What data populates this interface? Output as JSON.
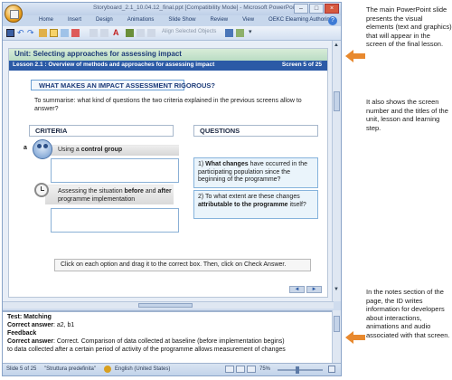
{
  "window": {
    "title": "Storyboard_2.1_10.04.12_final.ppt [Compatibility Mode] - Microsoft PowerPoint",
    "minimize": "–",
    "maximize": "□",
    "close": "×"
  },
  "ribbon": {
    "tabs": [
      "Home",
      "Insert",
      "Design",
      "Animations",
      "Slide Show",
      "Review",
      "View",
      "OEKC Elearning Authoring"
    ],
    "help": "?"
  },
  "toolbar": {
    "undo": "↶",
    "redo": "↷",
    "font_color": "A",
    "align_selected": "Align Selected Objects",
    "more": "▾"
  },
  "slide": {
    "unit_title": "Unit: Selecting approaches for assessing impact",
    "lesson_title": "Lesson 2.1 : Overview of methods and approaches for assessing impact",
    "screen_number": "Screen 5 of 25",
    "question_banner": "WHAT MAKES AN IMPACT ASSESSMENT RIGOROUS?",
    "intro": "To summarise: what kind of questions the two criteria explained in the previous screens allow to answer?",
    "criteria_header": "CRITERIA",
    "questions_header": "QUESTIONS",
    "option_a_letter": "a",
    "option_a_prefix": "Using a ",
    "option_a_bold": "control group",
    "option_b_prefix": "Assessing the situation ",
    "option_b_bold1": "before",
    "option_b_mid": " and ",
    "option_b_bold2": "after",
    "option_b_suffix": " programme implementation",
    "q1_prefix": "1) ",
    "q1_bold": "What changes",
    "q1_suffix": " have occurred in the participating population since the beginning of the programme?",
    "q2_prefix": "2) To what extent are these changes ",
    "q2_bold": "attributable to the programme",
    "q2_suffix": " itself?",
    "instruction": "Click on each option and drag it to the correct box. Then, click on Check Answer.",
    "nav_prev": "◄",
    "nav_next": "►"
  },
  "notes": {
    "test": "Test: Matching",
    "answer_label": "Correct answer",
    "answer_value": ": a2, b1",
    "feedback_label": "Feedback",
    "correct_label": "Correct answer",
    "feedback_text1": ": Correct. Comparison of data collected at baseline (before implementation begins)",
    "feedback_text2": "to data collected after a certain period of activity of the programme allows measurement  of changes"
  },
  "statusbar": {
    "slide": "Slide 5 of 25",
    "theme": "\"Struttura predefinita\"",
    "language": "English (United States)",
    "zoom": "75%"
  },
  "annotations": {
    "p1": "The main PowerPoint slide presents the visual elements (text and graphics) that will appear in the screen of the final lesson.",
    "p2": "It also shows the screen number and the titles of the unit, lesson and learning step.",
    "p3": "In the notes section of the page, the ID writes information for developers about interactions, animations and audio associated with that screen."
  },
  "colors": {
    "accent_arrow": "#e8892e",
    "lesson_bar": "#2b5aa6",
    "unit_bar": "#b9dcc4"
  }
}
